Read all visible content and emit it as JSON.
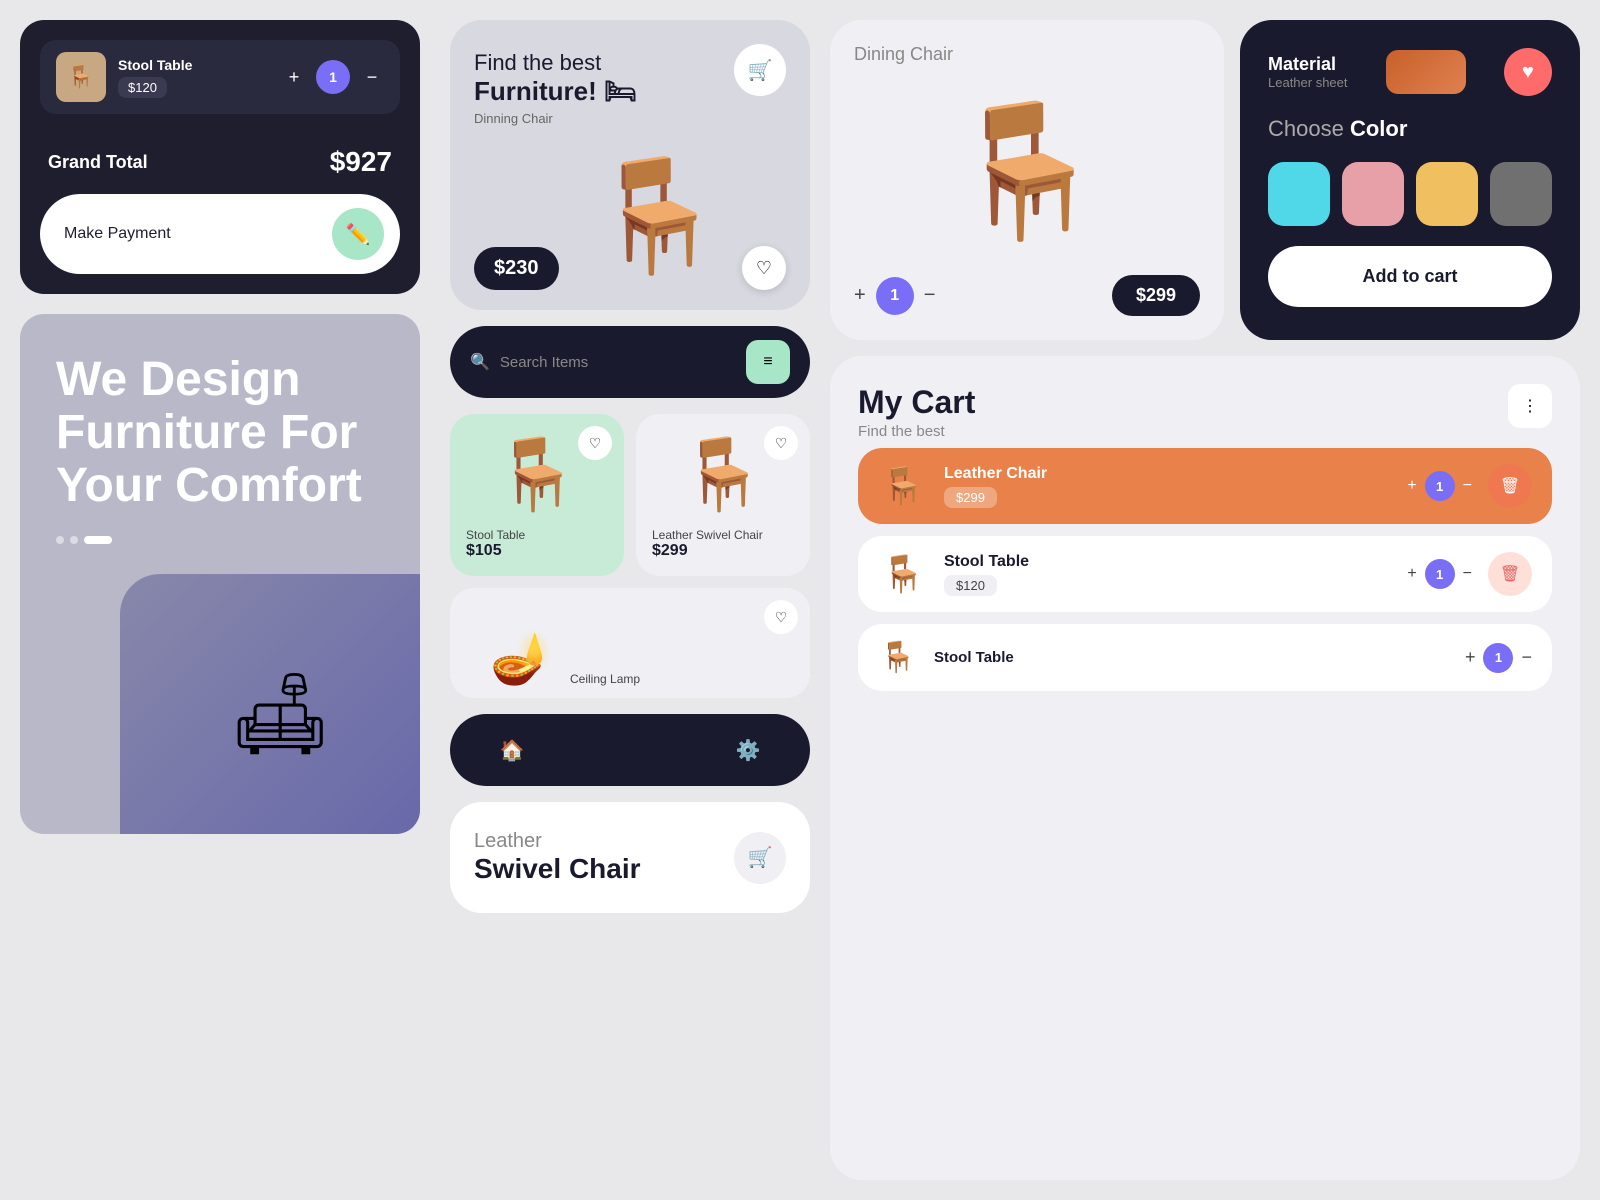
{
  "left": {
    "cart_item": {
      "name": "Stool Table",
      "price": "$120",
      "qty": 1
    },
    "grand_total_label": "Grand",
    "grand_total_bold": "Total",
    "grand_total_amount": "$927",
    "make_payment_label": "Make Payment"
  },
  "hero": {
    "line1": "We Design",
    "line2": "Furniture For",
    "line3": "Your Comfort"
  },
  "middle": {
    "banner": {
      "text_top": "Find the best",
      "text_bold": "Furniture! 🛏",
      "subtitle": "Dinning Chair",
      "price": "$230"
    },
    "search": {
      "placeholder": "Search Items"
    },
    "products": [
      {
        "name": "Stool Table",
        "price": "$105",
        "bg": "green"
      },
      {
        "name": "Leather Swivel Chair",
        "price": "$299",
        "bg": "light"
      }
    ],
    "product3": {
      "name": "Ceiling Lamp"
    },
    "bottom_detail": {
      "label": "Leather",
      "name": "Swivel Chair"
    }
  },
  "right": {
    "dining": {
      "label": "Dining Chair",
      "qty": 1,
      "price": "$299"
    },
    "material": {
      "title": "Material",
      "subtitle": "Leather sheet",
      "choose_color_label": "Choose",
      "choose_color_bold": "Color",
      "colors": [
        "#50d8e8",
        "#e8a0a8",
        "#f0c060",
        "#707070"
      ],
      "add_to_cart": "Add to cart"
    },
    "my_cart": {
      "title": "My Cart",
      "subtitle": "Find the best",
      "items": [
        {
          "name": "Leather Chair",
          "price": "$299",
          "qty": 1,
          "style": "orange"
        },
        {
          "name": "Stool Table",
          "price": "$120",
          "qty": 1,
          "style": "white"
        }
      ]
    }
  }
}
